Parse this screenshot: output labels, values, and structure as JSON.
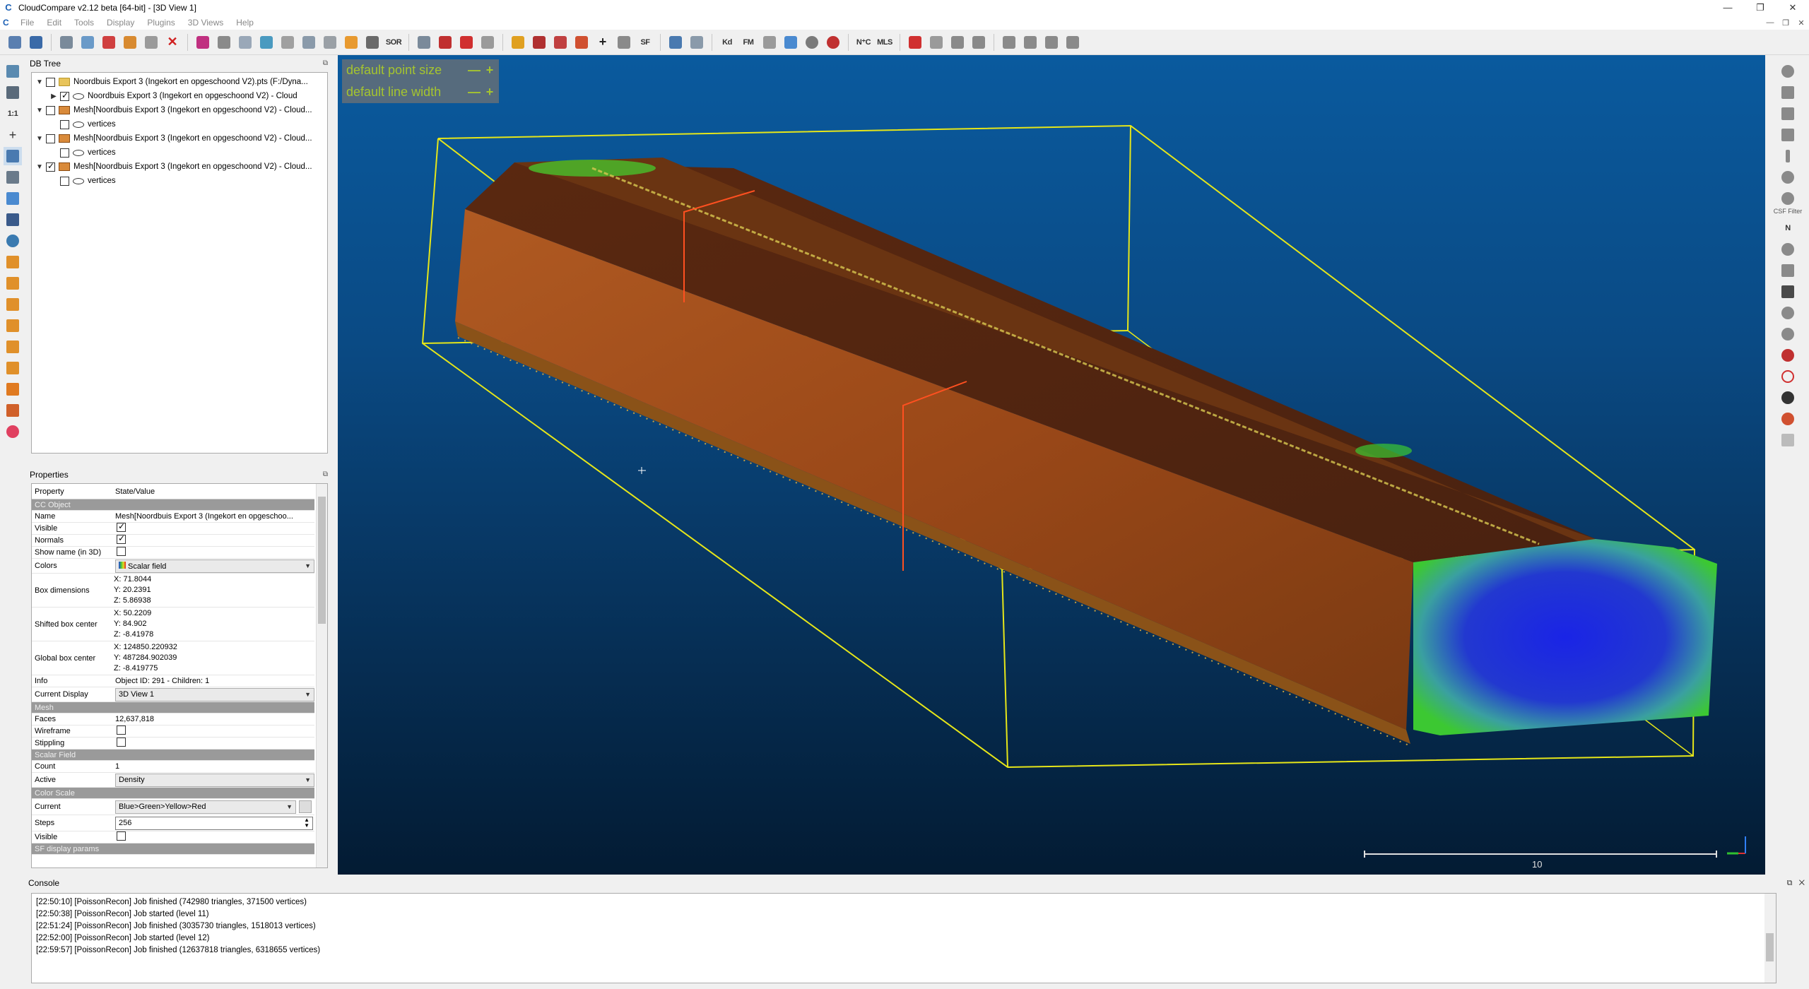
{
  "window": {
    "title": "CloudCompare v2.12 beta [64-bit] - [3D View 1]",
    "controls": [
      "—",
      "❐",
      "✕"
    ],
    "mdi_controls": [
      "—",
      "❐",
      "✕"
    ]
  },
  "menu": [
    "File",
    "Edit",
    "Tools",
    "Display",
    "Plugins",
    "3D Views",
    "Help"
  ],
  "toolbar": {
    "labels": {
      "sor": "SOR",
      "sf": "SF",
      "nc": "N⁺C",
      "mls": "MLS",
      "kd": "Kd",
      "fm": "FM"
    }
  },
  "lefttoolbar": {
    "ratio_label": "1:1"
  },
  "righttoolbar": {
    "csf_label": "CSF Filter",
    "n_label": "N"
  },
  "dbtree": {
    "title": "DB Tree",
    "rows": [
      {
        "label": "Noordbuis Export 3 (Ingekort en opgeschoond V2).pts (F:/Dyna...",
        "arrow": "▼",
        "checked": false,
        "icon": "folder",
        "indent": 0
      },
      {
        "label": "Noordbuis Export 3 (Ingekort en opgeschoond V2) - Cloud",
        "arrow": "▶",
        "checked": true,
        "icon": "cloud",
        "indent": 1
      },
      {
        "label": "Mesh[Noordbuis Export 3 (Ingekort en opgeschoond V2) - Cloud...",
        "arrow": "▼",
        "checked": false,
        "icon": "mesh",
        "indent": 0
      },
      {
        "label": "vertices",
        "arrow": "",
        "checked": false,
        "icon": "cloud",
        "indent": 1
      },
      {
        "label": "Mesh[Noordbuis Export 3 (Ingekort en opgeschoond V2) - Cloud...",
        "arrow": "▼",
        "checked": false,
        "icon": "mesh",
        "indent": 0
      },
      {
        "label": "vertices",
        "arrow": "",
        "checked": false,
        "icon": "cloud",
        "indent": 1
      },
      {
        "label": "Mesh[Noordbuis Export 3 (Ingekort en opgeschoond V2) - Cloud...",
        "arrow": "▼",
        "checked": true,
        "icon": "mesh",
        "indent": 0
      },
      {
        "label": "vertices",
        "arrow": "",
        "checked": false,
        "icon": "cloud",
        "indent": 1
      }
    ]
  },
  "properties": {
    "title": "Properties",
    "header": {
      "property": "Property",
      "value": "State/Value"
    },
    "sections": {
      "cc_object": "CC Object",
      "mesh": "Mesh",
      "scalar_field": "Scalar Field",
      "color_scale": "Color Scale",
      "sf_display": "SF display params"
    },
    "name_label": "Name",
    "name_value": "Mesh[Noordbuis Export 3 (Ingekort en opgeschoo...",
    "visible_label": "Visible",
    "normals_label": "Normals",
    "show_name_label": "Show name (in 3D)",
    "colors_label": "Colors",
    "colors_value": "Scalar field",
    "box_dim_label": "Box dimensions",
    "box_dim": [
      "X: 71.8044",
      "Y: 20.2391",
      "Z: 5.86938"
    ],
    "shifted_center_label": "Shifted box center",
    "shifted_center": [
      "X: 50.2209",
      "Y: 84.902",
      "Z: -8.41978"
    ],
    "global_center_label": "Global box center",
    "global_center": [
      "X: 124850.220932",
      "Y: 487284.902039",
      "Z: -8.419775"
    ],
    "info_label": "Info",
    "info_value": "Object ID: 291 - Children: 1",
    "current_display_label": "Current Display",
    "current_display_value": "3D View 1",
    "faces_label": "Faces",
    "faces_value": "12,637,818",
    "wireframe_label": "Wireframe",
    "stippling_label": "Stippling",
    "count_label": "Count",
    "count_value": "1",
    "active_label": "Active",
    "active_value": "Density",
    "current_label": "Current",
    "current_value": "Blue>Green>Yellow>Red",
    "steps_label": "Steps",
    "steps_value": "256",
    "cs_visible_label": "Visible"
  },
  "view": {
    "overlay": {
      "point_size": "default point size",
      "line_width": "default line width",
      "minus": "—",
      "plus": "+"
    },
    "scale_label": "10",
    "colors": {
      "bg_top": "#0a5a9e",
      "bg_bottom": "#031b33",
      "bbox": "#e6e619",
      "mesh_top": "#5a2a10",
      "mesh_side": "#a0461c",
      "mesh_end_blue": "#1428e6",
      "mesh_end_green": "#3cc832"
    }
  },
  "console": {
    "title": "Console",
    "lines": [
      "[22:50:10] [PoissonRecon] Job finished (742980 triangles, 371500 vertices)",
      "[22:50:38] [PoissonRecon] Job started (level 11)",
      "[22:51:24] [PoissonRecon] Job finished (3035730 triangles, 1518013 vertices)",
      "[22:52:00] [PoissonRecon] Job started (level 12)",
      "[22:59:57] [PoissonRecon] Job finished (12637818 triangles, 6318655 vertices)"
    ]
  }
}
